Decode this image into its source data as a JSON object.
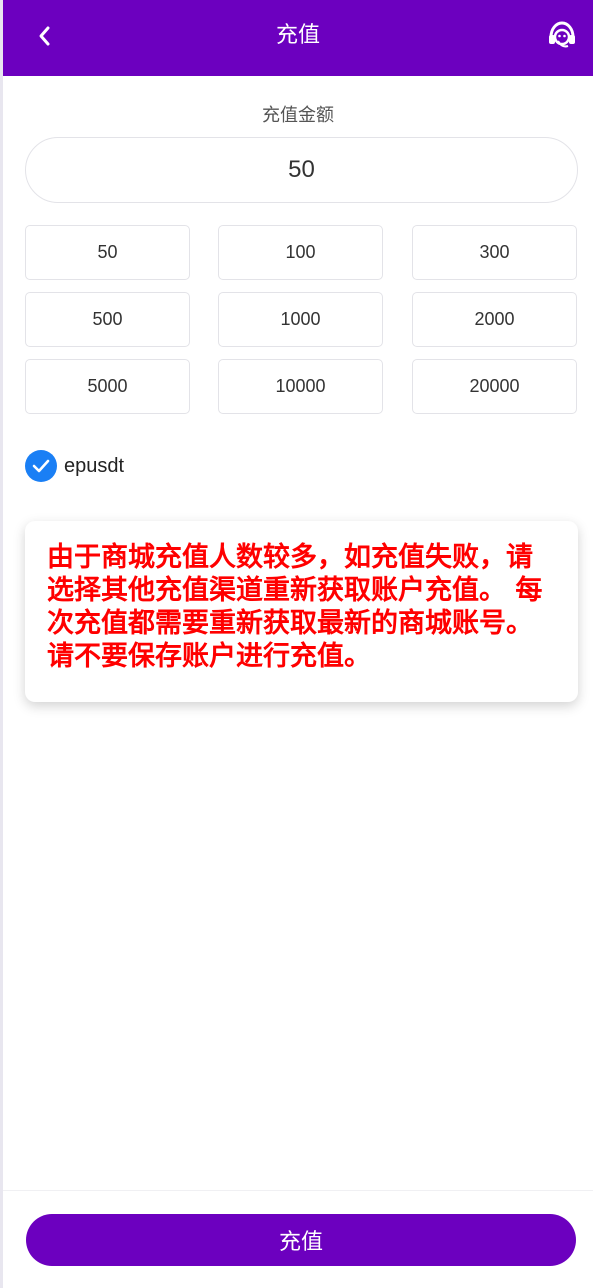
{
  "header": {
    "title": "充值",
    "back_icon": "chevron-left-icon",
    "support_icon": "headset-icon"
  },
  "amount": {
    "label": "充值金额",
    "value": "50"
  },
  "presets": [
    "50",
    "100",
    "300",
    "500",
    "1000",
    "2000",
    "5000",
    "10000",
    "20000"
  ],
  "payment_method": {
    "label": "epusdt",
    "selected": true
  },
  "notice": {
    "text": "由于商城充值人数较多，如充值失败，请选择其他充值渠道重新获取账户充值。 每次充值都需要重新获取最新的商城账号。 请不要保存账户进行充值。"
  },
  "submit": {
    "label": "充值"
  },
  "colors": {
    "primary": "#6c00bf",
    "check": "#1a7ff5",
    "notice_text": "#ff0000"
  }
}
